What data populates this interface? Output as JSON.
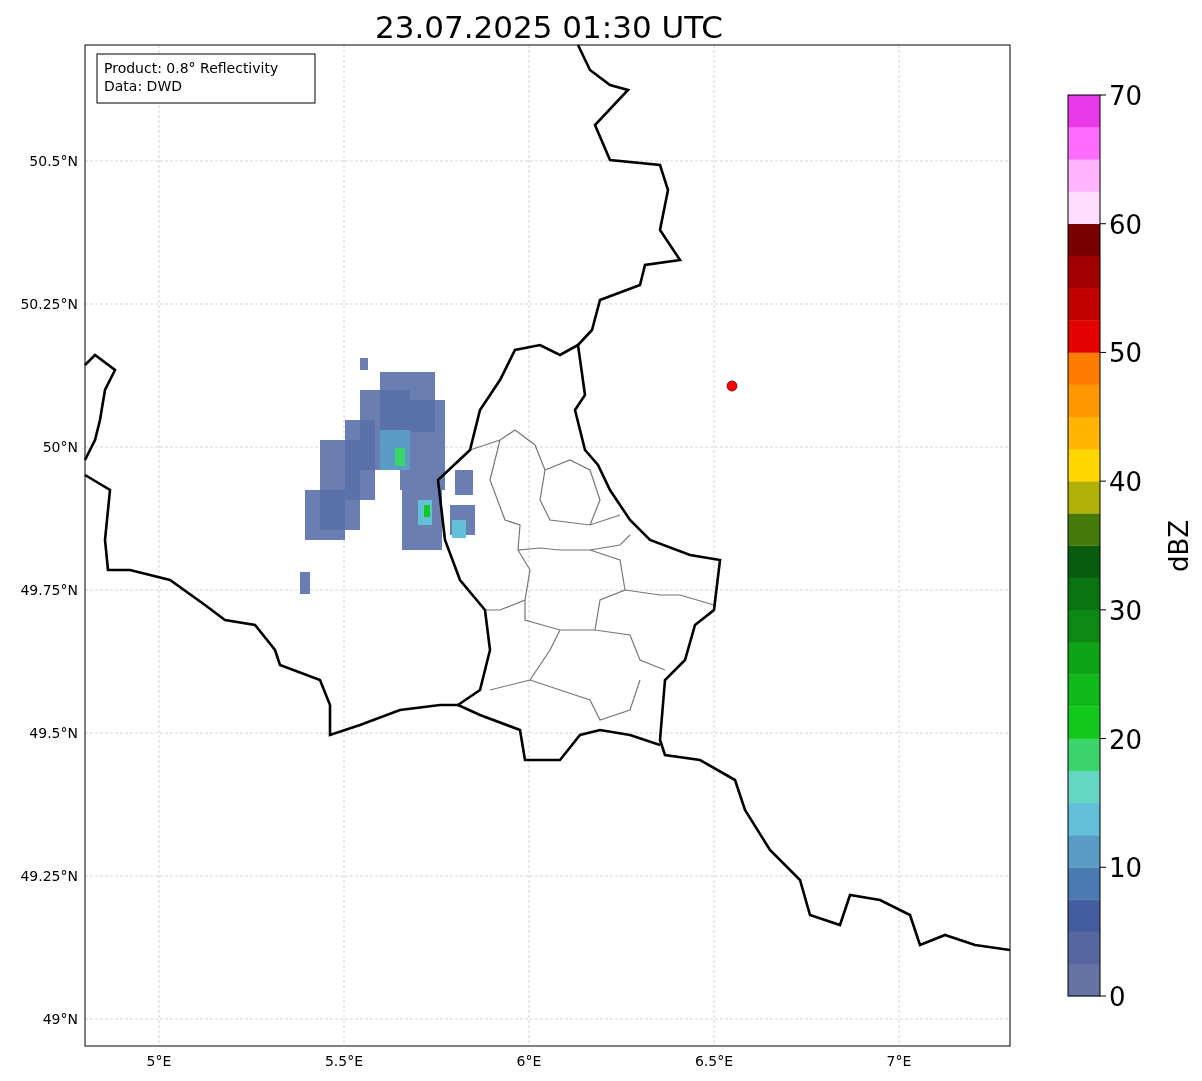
{
  "title": "23.07.2025 01:30 UTC",
  "info_box": [
    "Product: 0.8° Reflectivity",
    "Data: DWD"
  ],
  "x_ticks": [
    "5°E",
    "5.5°E",
    "6°E",
    "6.5°E",
    "7°E"
  ],
  "y_ticks": [
    "50.5°N",
    "50.25°N",
    "50°N",
    "49.75°N",
    "49.5°N",
    "49.25°N",
    "49°N"
  ],
  "colorbar": {
    "label": "dBZ",
    "ticks": [
      "70",
      "60",
      "50",
      "40",
      "30",
      "20",
      "10",
      "0"
    ],
    "bands": [
      {
        "color": "#6473a4"
      },
      {
        "color": "#5566a0"
      },
      {
        "color": "#435d9f"
      },
      {
        "color": "#4a7ab0"
      },
      {
        "color": "#5a9cc4"
      },
      {
        "color": "#63c0d8"
      },
      {
        "color": "#63d6c4"
      },
      {
        "color": "#3cd56c"
      },
      {
        "color": "#12c81a"
      },
      {
        "color": "#10b91a"
      },
      {
        "color": "#0ea317"
      },
      {
        "color": "#0c8a14"
      },
      {
        "color": "#0a7312"
      },
      {
        "color": "#095c0e"
      },
      {
        "color": "#457a0b"
      },
      {
        "color": "#b0b007"
      },
      {
        "color": "#ffd700"
      },
      {
        "color": "#ffb400"
      },
      {
        "color": "#ff9800"
      },
      {
        "color": "#ff7c00"
      },
      {
        "color": "#e20000"
      },
      {
        "color": "#c10000"
      },
      {
        "color": "#a00000"
      },
      {
        "color": "#780000"
      },
      {
        "color": "#ffdcff"
      },
      {
        "color": "#ffb4ff"
      },
      {
        "color": "#ff6cff"
      },
      {
        "color": "#e838e8"
      }
    ]
  }
}
